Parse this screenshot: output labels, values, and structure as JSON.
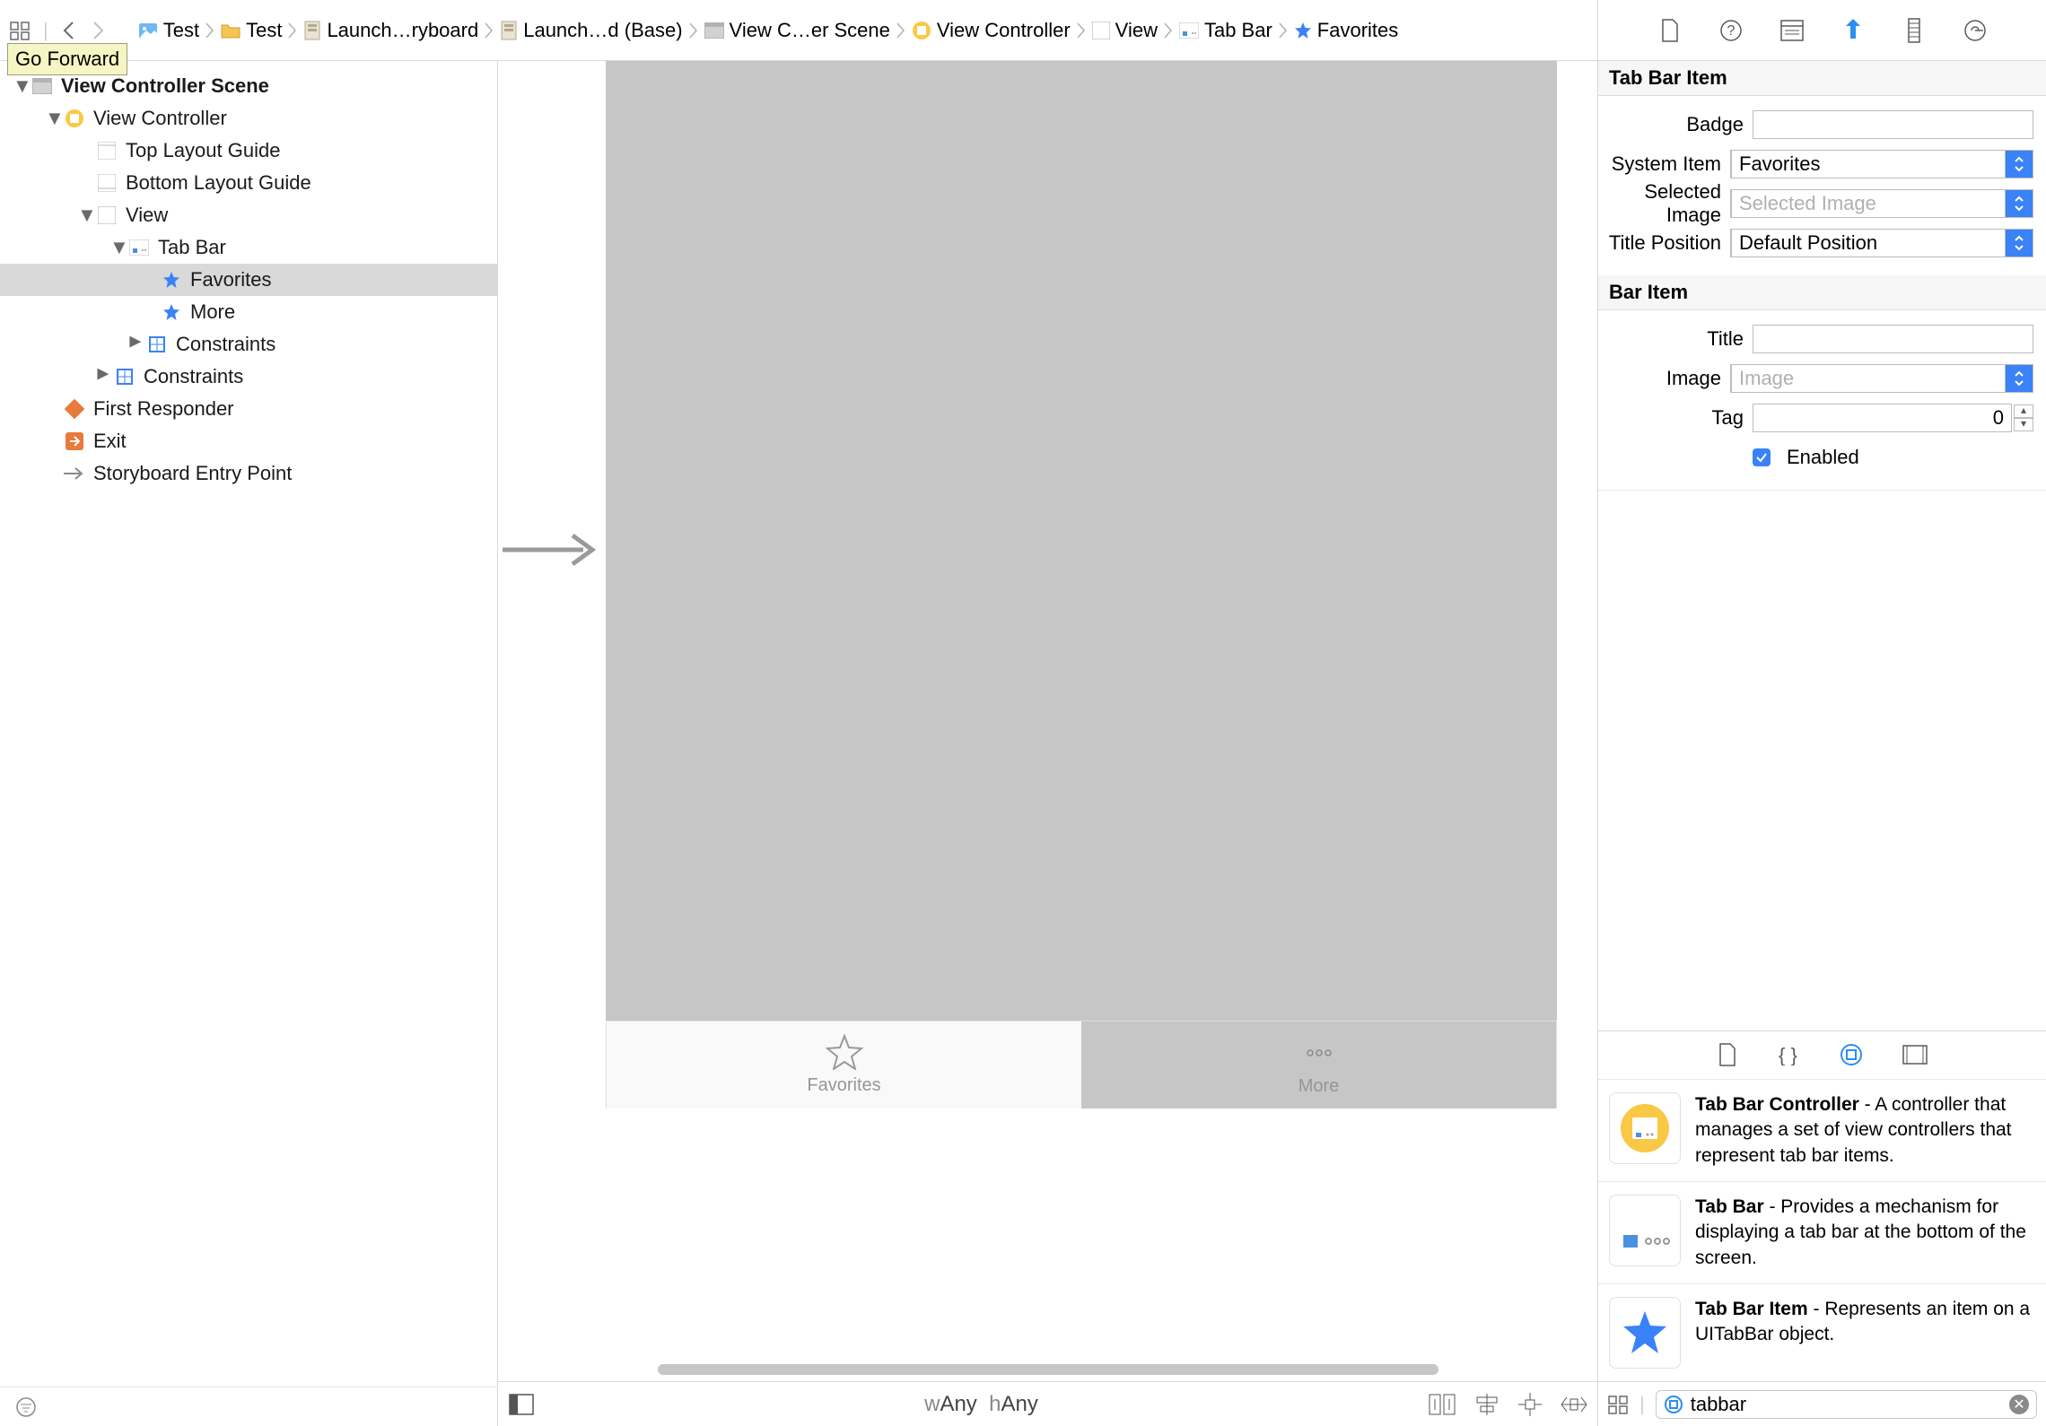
{
  "tooltip": "Go Forward",
  "breadcrumbs": [
    {
      "icon": "image-blue",
      "label": "Test"
    },
    {
      "icon": "folder",
      "label": "Test"
    },
    {
      "icon": "storyboard",
      "label": "Launch…ryboard"
    },
    {
      "icon": "storyboard",
      "label": "Launch…d (Base)"
    },
    {
      "icon": "scene",
      "label": "View C…er Scene"
    },
    {
      "icon": "viewcontroller",
      "label": "View Controller"
    },
    {
      "icon": "view",
      "label": "View"
    },
    {
      "icon": "tabbar",
      "label": "Tab Bar"
    },
    {
      "icon": "star",
      "label": "Favorites"
    }
  ],
  "outline": {
    "scene": "View Controller Scene",
    "viewController": "View Controller",
    "topGuide": "Top Layout Guide",
    "bottomGuide": "Bottom Layout Guide",
    "view": "View",
    "tabBar": "Tab Bar",
    "favorites": "Favorites",
    "more": "More",
    "constraints1": "Constraints",
    "constraints2": "Constraints",
    "firstResponder": "First Responder",
    "exit": "Exit",
    "entry": "Storyboard Entry Point"
  },
  "canvas": {
    "tab1": "Favorites",
    "tab2": "More",
    "wAny": "Any",
    "hAny": "Any",
    "wPrefix": "w",
    "hPrefix": "h"
  },
  "inspector": {
    "section_tabBarItem": "Tab Bar Item",
    "badge_lbl": "Badge",
    "badge_val": "",
    "systemItem_lbl": "System Item",
    "systemItem_val": "Favorites",
    "selectedImage_lbl": "Selected Image",
    "selectedImage_ph": "Selected Image",
    "titlePosition_lbl": "Title Position",
    "titlePosition_val": "Default Position",
    "section_barItem": "Bar Item",
    "title_lbl": "Title",
    "title_val": "",
    "image_lbl": "Image",
    "image_ph": "Image",
    "tag_lbl": "Tag",
    "tag_val": "0",
    "enabled_lbl": "Enabled"
  },
  "library": {
    "items": [
      {
        "title": "Tab Bar Controller",
        "desc": " - A controller that manages a set of view controllers that represent tab bar items."
      },
      {
        "title": "Tab Bar",
        "desc": " - Provides a mechanism for displaying a tab bar at the bottom of the screen."
      },
      {
        "title": "Tab Bar Item",
        "desc": " - Represents an item on a UITabBar object."
      }
    ],
    "search": "tabbar"
  }
}
